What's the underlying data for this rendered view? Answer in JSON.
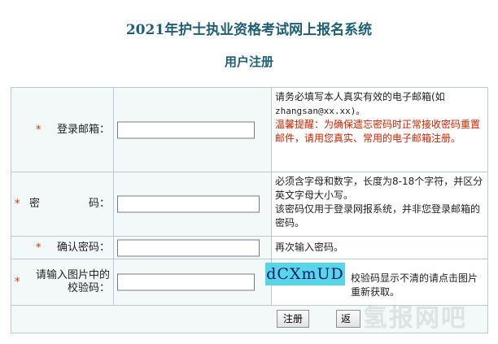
{
  "site": {
    "title": "2021年护士执业资格考试网上报名系统",
    "page_title": "用户注册"
  },
  "required_mark": "*",
  "fields": {
    "email": {
      "label": "登录邮箱：",
      "value": "",
      "hint_1": "请务必填写本人真实有效的电子邮箱(如",
      "hint_2": "zhangsan@xx.xx)。",
      "warning": "温馨提醒：为确保遗忘密码时正常接收密码重置邮件，请用您真实、常用的电子邮箱注册。"
    },
    "password": {
      "label_left": "密",
      "label_right": "码：",
      "value": "",
      "hint_1": "必须含字母和数字，长度为8-18个字符，并区分英文字母大小写。",
      "hint_2": "该密码仅用于登录网报系统，并非您登录邮箱的密码。"
    },
    "confirm": {
      "label": "确认密码：",
      "value": "",
      "hint": "再次输入密码。"
    },
    "captcha": {
      "label_1": "请输入图片中的",
      "label_2": "校验码：",
      "value": "",
      "image_text": "dCXmUD",
      "hint": "校验码显示不清的请点击图片重新获取。"
    }
  },
  "buttons": {
    "register": "注册",
    "back": "返回"
  },
  "watermark": "氢报网吧",
  "colors": {
    "title": "#1f5f73",
    "required": "#cc3300",
    "warning": "#cc2200",
    "captcha_bg": "#56d6e8",
    "row_bg": "#f3f9f9",
    "border": "#b9c9cf"
  }
}
